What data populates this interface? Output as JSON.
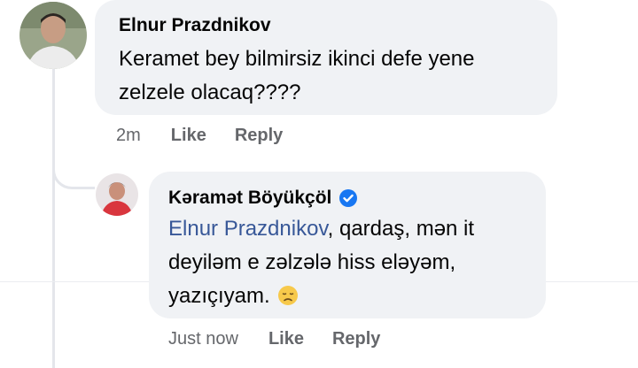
{
  "comments": [
    {
      "author": "Elnur Prazdnikov",
      "text_lines": [
        "Keramet bey bilmirsiz ikinci defe yene",
        "zelzele olacaq????"
      ],
      "time": "2m",
      "like_label": "Like",
      "reply_label": "Reply"
    }
  ],
  "reply": {
    "author": "Kəramət Böyükçöl",
    "verified_icon": "verified-badge-icon",
    "mention": "Elnur Prazdnikov",
    "text_line1_rest": ", qardaş, mən it",
    "text_line2": "deyiləm e zəlzələ hiss eləyəm,",
    "text_line3": "yazıçıyam.",
    "emoji": "disappointed-face-icon",
    "time": "Just now",
    "like_label": "Like",
    "reply_label": "Reply"
  },
  "colors": {
    "bubble": "#f0f2f5",
    "text": "#050505",
    "secondary": "#65676b",
    "mention": "#385898",
    "verified": "#1877f2"
  }
}
